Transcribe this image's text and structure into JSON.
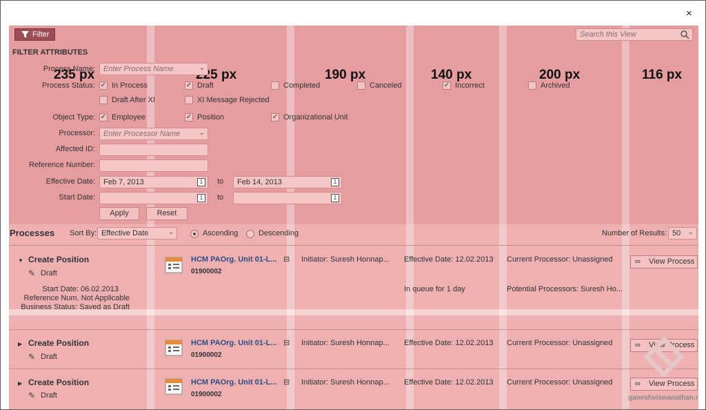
{
  "dialog": {
    "close_label": "×"
  },
  "toolbar": {
    "filter_label": "Filter",
    "search_placeholder": "Search this View"
  },
  "filter": {
    "heading": "FILTER ATTRIBUTES",
    "process_name_label": "Process Name:",
    "process_name_placeholder": "Enter Process Name",
    "process_status_label": "Process Status:",
    "statuses": [
      {
        "label": "In Process",
        "checked": true
      },
      {
        "label": "Draft",
        "checked": true
      },
      {
        "label": "Completed",
        "checked": false
      },
      {
        "label": "Canceled",
        "checked": false
      },
      {
        "label": "Incorrect",
        "checked": true
      },
      {
        "label": "Archived",
        "checked": false
      },
      {
        "label": "Draft After XI",
        "checked": false
      },
      {
        "label": "XI Message Rejected",
        "checked": false
      }
    ],
    "object_type_label": "Object Type:",
    "object_types": [
      {
        "label": "Employee",
        "checked": true
      },
      {
        "label": "Position",
        "checked": true
      },
      {
        "label": "Organizational Unit",
        "checked": true
      }
    ],
    "processor_label": "Processor:",
    "processor_placeholder": "Enter Processor Name",
    "affected_id_label": "Affected ID:",
    "reference_number_label": "Reference Number:",
    "effective_date_label": "Effective Date:",
    "effective_from": "Feb 7, 2013",
    "to_label": "to",
    "effective_to": "Feb 14, 2013",
    "start_date_label": "Start Date:",
    "apply_label": "Apply",
    "reset_label": "Reset"
  },
  "column_widths": [
    "235 px",
    "225 px",
    "190 px",
    "140 px",
    "200 px",
    "116 px"
  ],
  "processes": {
    "title": "Processes",
    "sort_by_label": "Sort By:",
    "sort_by_value": "Effective Date",
    "ascending_label": "Ascending",
    "descending_label": "Descending",
    "sort_order": "ascending",
    "results_label": "Number of Results:",
    "results_value": "50",
    "items": [
      {
        "expanded": true,
        "title": "Create Position",
        "status": "Draft",
        "start_date": "Start Date: 06.02.2013",
        "reference": "Reference Num. Not Applicable",
        "business_status": "Business Status: Saved as Draft",
        "object_name": "HCM PAOrg. Unit 01-L...",
        "object_id": "01900002",
        "initiator": "Initiator: Suresh Honnap...",
        "effective_date": "Effective Date: 12.02.2013",
        "queue": "In queue for 1 day",
        "current_processor": "Current Processor: Unassigned",
        "potential_processors": "Potential Processors: Suresh Ho...",
        "view_label": "View Process"
      },
      {
        "expanded": false,
        "title": "Create Position",
        "status": "Draft",
        "object_name": "HCM PAOrg. Unit 01-L...",
        "object_id": "01900002",
        "initiator": "Initiator: Suresh Honnap...",
        "effective_date": "Effective Date: 12.02.2013",
        "current_processor": "Current Processor: Unassigned",
        "view_label": "View Process"
      },
      {
        "expanded": false,
        "title": "Create Position",
        "status": "Draft",
        "object_name": "HCM PAOrg. Unit 01-L...",
        "object_id": "01900002",
        "initiator": "Initiator: Suresh Honnap...",
        "effective_date": "Effective Date: 12.02.2013",
        "current_processor": "Current Processor: Unassigned",
        "view_label": "View Process"
      }
    ]
  },
  "watermark": {
    "text": "ganeshviswanathan.net"
  },
  "colors": {
    "overlay": "#eeb0b0",
    "filter_button": "#9c4d55",
    "link": "#2c4d86"
  }
}
